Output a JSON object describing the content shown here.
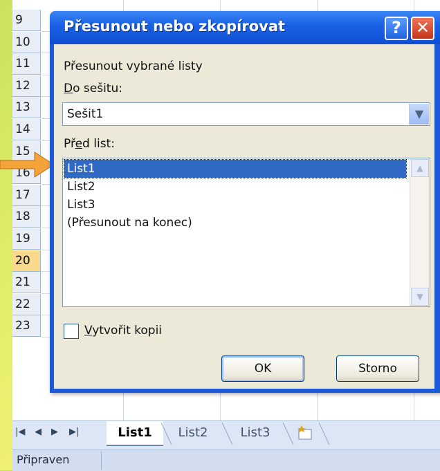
{
  "sheet": {
    "row_numbers": [
      "9",
      "10",
      "11",
      "12",
      "13",
      "14",
      "15",
      "16",
      "17",
      "18",
      "19",
      "20",
      "21",
      "22",
      "23"
    ],
    "active_row": "20"
  },
  "dialog": {
    "title": "Přesunout nebo zkopírovat",
    "help_label": "?",
    "close_label": "✕",
    "move_selected_label": "Přesunout vybrané listy",
    "to_workbook_label_pre": "",
    "to_workbook_label_ul": "D",
    "to_workbook_label_post": "o sešitu:",
    "workbook_value": "Sešit1",
    "before_sheet_label_pre": "Př",
    "before_sheet_label_ul": "e",
    "before_sheet_label_post": "d list:",
    "sheets": [
      "List1",
      "List2",
      "List3",
      "(Přesunout na konec)"
    ],
    "selected_sheet": "List1",
    "copy_label_ul": "V",
    "copy_label_post": "ytvořit kopii",
    "copy_checked": false,
    "ok_label": "OK",
    "cancel_label": "Storno"
  },
  "tabs": {
    "items": [
      "List1",
      "List2",
      "List3"
    ],
    "active": "List1",
    "nav_first": "|◀",
    "nav_prev": "◀",
    "nav_next": "▶",
    "nav_last": "▶|"
  },
  "status": {
    "text": "Připraven"
  },
  "colors": {
    "titlebar": "#1c62e6",
    "selection": "#316ac5",
    "active_row_header": "#f9d98b"
  }
}
